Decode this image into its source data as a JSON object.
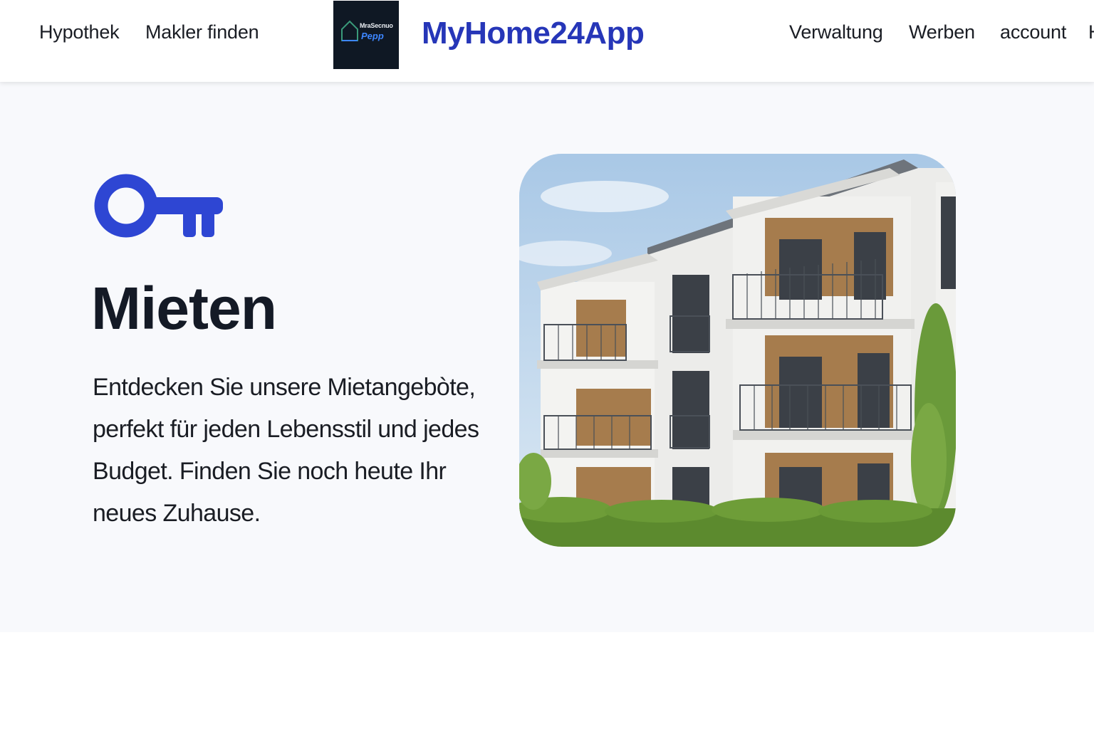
{
  "nav": {
    "left_links": [
      "Hypothek",
      "Makler finden"
    ],
    "right_links": [
      "Verwaltung",
      "Werben",
      "account",
      "H"
    ]
  },
  "brand": {
    "logo_text_top": "MraSecnuo",
    "logo_text_bottom": "Pepp",
    "title": "MyHome24App",
    "color": "#2636b8"
  },
  "hero": {
    "icon": "key-icon",
    "icon_color": "#2e46d3",
    "title": "Mieten",
    "description": "Entdecken Sie unsere Mietangebòte, perfekt für jeden Lebensstil und jedes Budget. Finden Sie noch heute Ihr neues Zuhause.",
    "image": "apartment-building-photo"
  },
  "colors": {
    "hero_background": "#f8f9fc",
    "text_dark": "#141a26"
  }
}
